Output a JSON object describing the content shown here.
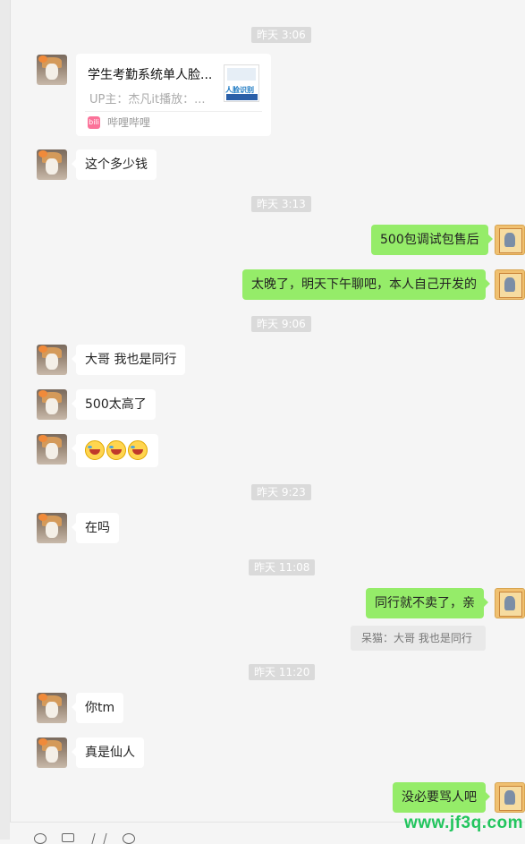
{
  "timestamps": [
    "昨天 3:06",
    "昨天 3:13",
    "昨天 9:06",
    "昨天 9:23",
    "昨天 11:08",
    "昨天 11:20"
  ],
  "link_card": {
    "title": "学生考勤系统单人脸...",
    "uploader": "UP主：杰凡it播放：...",
    "source": "哔哩哔哩",
    "source_icon_label": "bili",
    "thumb_text": "人脸识别"
  },
  "messages": {
    "m1": "这个多少钱",
    "m2": "500包调试包售后",
    "m3": "太晚了，明天下午聊吧，本人自己开发的",
    "m4": "大哥  我也是同行",
    "m5": "500太高了",
    "m6": "在吗",
    "m7": "同行就不卖了，亲",
    "m8": "你tm",
    "m9": "真是仙人",
    "m10": "没必要骂人吧"
  },
  "quote": "呆猫：大哥  我也是同行",
  "emojis": [
    "laughing-crying-icon",
    "laughing-crying-icon",
    "laughing-crying-icon"
  ],
  "watermark": "www.jf3q.com",
  "toolbar_icons": [
    "emoji-icon",
    "folder-icon",
    "scissors-icon",
    "chat-history-icon"
  ]
}
